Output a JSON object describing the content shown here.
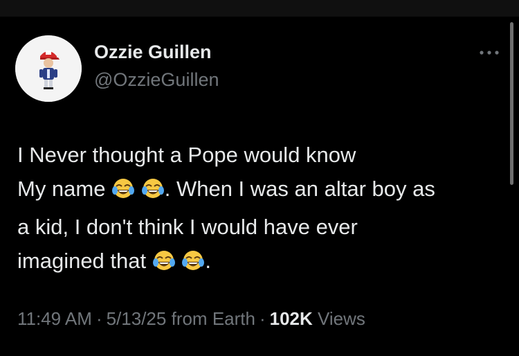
{
  "author": {
    "display_name": "Ozzie Guillen",
    "handle": "@OzzieGuillen",
    "avatar_icon": "baseball-player-avatar"
  },
  "tweet": {
    "line1": "I Never thought a Pope would know",
    "line2_prefix": "My name",
    "line2_suffix": ". When I was an altar boy as",
    "line3": "a kid, I don't think I would have ever",
    "line4_prefix": "imagined that",
    "line4_suffix": ".",
    "emoji_icon": "face-with-tears-of-joy"
  },
  "meta": {
    "time": "11:49 AM",
    "separator": "·",
    "date": "5/13/25",
    "source": "from Earth",
    "views_count": "102K",
    "views_label": "Views"
  },
  "more_icon": "more-dots-icon",
  "colors": {
    "background": "#000000",
    "primary_text": "#e7e9ea",
    "secondary_text": "#71767b"
  }
}
